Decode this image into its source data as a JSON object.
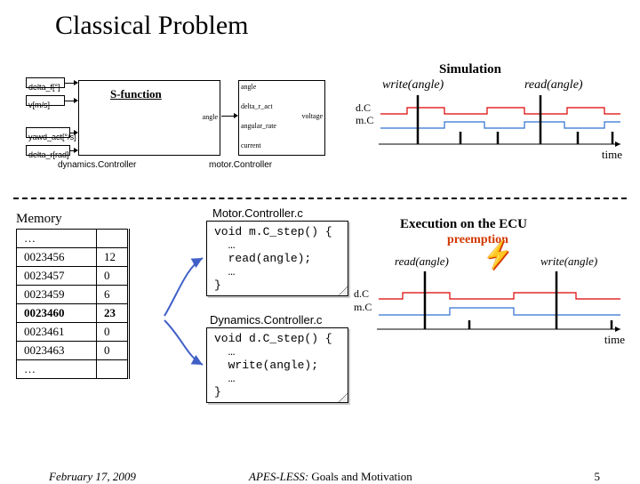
{
  "title": "Classical Problem",
  "simulink": {
    "inputs": [
      "delta_f[°]",
      "v[m/s]",
      "yawd_act[°/s]",
      "delta_r[rad]"
    ],
    "sfuncLabel": "S-function",
    "sfuncOut": "angle",
    "motorInputs": [
      "angle",
      "delta_r_act",
      "angular_rate",
      "current"
    ],
    "motorOut": "voltage",
    "dynName": "dynamics.Controller",
    "motName": "motor.Controller"
  },
  "sim": {
    "heading": "Simulation",
    "write": "write(angle)",
    "read": "read(angle)",
    "dC": "d.C",
    "mC": "m.C",
    "time": "time"
  },
  "memory": {
    "heading": "Memory",
    "rows": [
      {
        "addr": "…",
        "val": ""
      },
      {
        "addr": "0023456",
        "val": "12"
      },
      {
        "addr": "0023457",
        "val": "0"
      },
      {
        "addr": "0023459",
        "val": "6"
      },
      {
        "addr": "0023460",
        "val": "23",
        "bold": true
      },
      {
        "addr": "0023461",
        "val": "0"
      },
      {
        "addr": "0023463",
        "val": "0"
      },
      {
        "addr": "…",
        "val": ""
      }
    ]
  },
  "code": {
    "motorLabel": "Motor.Controller.c",
    "motorCode": "void m.C_step() {\n  …\n  read(angle);\n  …\n}",
    "dynLabel": "Dynamics.Controller.c",
    "dynCode": "void d.C_step() {\n  …\n  write(angle);\n  …\n}"
  },
  "exec": {
    "heading": "Execution on the ECU",
    "preemption": "preemption",
    "read": "read(angle)",
    "write": "write(angle)",
    "dC": "d.C",
    "mC": "m.C",
    "time": "time"
  },
  "footer": {
    "date": "February 17, 2009",
    "middle": "APES-LESS: Goals and Motivation",
    "page": "5"
  }
}
